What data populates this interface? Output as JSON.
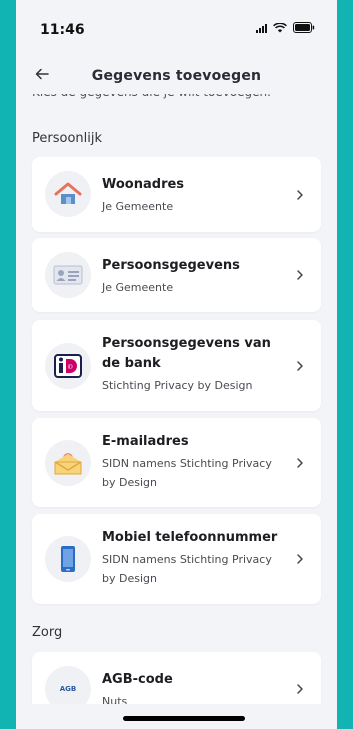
{
  "status": {
    "time": "11:46"
  },
  "nav": {
    "title": "Gegevens toevoegen"
  },
  "intro": "Kies de gegevens die je wilt toevoegen.",
  "sections": [
    {
      "title": "Persoonlijk",
      "items": [
        {
          "title": "Woonadres",
          "subtitle": "Je Gemeente",
          "icon": "house-icon"
        },
        {
          "title": "Persoonsgegevens",
          "subtitle": "Je Gemeente",
          "icon": "id-card-icon"
        },
        {
          "title": "Persoonsgegevens van de bank",
          "subtitle": "Stichting Privacy by Design",
          "icon": "ideal-bank-icon"
        },
        {
          "title": "E-mailadres",
          "subtitle": "SIDN namens Stichting Privacy by Design",
          "icon": "envelope-icon"
        },
        {
          "title": "Mobiel telefoonnummer",
          "subtitle": "SIDN namens Stichting Privacy by Design",
          "icon": "phone-icon"
        }
      ]
    },
    {
      "title": "Zorg",
      "items": [
        {
          "title": "AGB-code",
          "subtitle": "Nuts",
          "icon": "agb-logo-icon",
          "icon_text": "AGB"
        }
      ]
    }
  ],
  "colors": {
    "frame": "#12b3b3",
    "background": "#f3f4f8",
    "card": "#ffffff",
    "house_roof": "#e8735a",
    "house_body": "#5b8fc9",
    "envelope": "#f2b43c",
    "phone": "#2b6cc4",
    "ideal": "#1b1f4b"
  }
}
